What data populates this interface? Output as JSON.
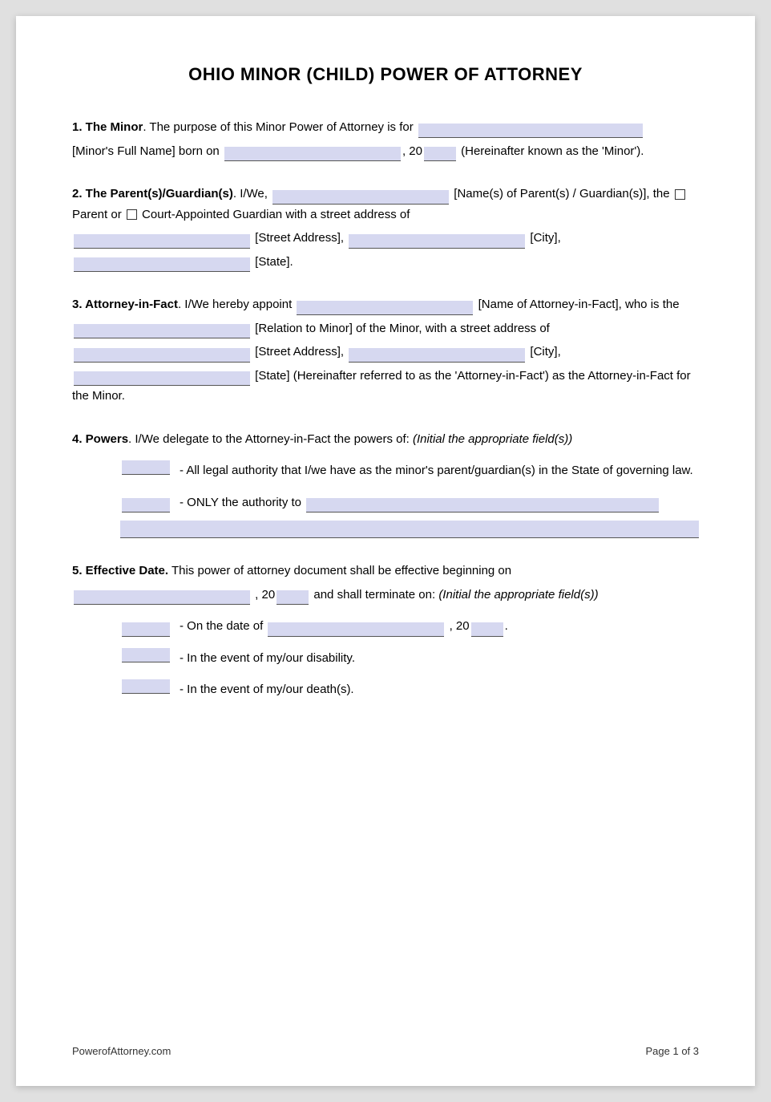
{
  "title": "OHIO MINOR (CHILD) POWER OF ATTORNEY",
  "sections": {
    "s1": {
      "label": "1. The Minor",
      "text1": ". The purpose of this Minor Power of Attorney is for",
      "text2": "[Minor's Full Name] born on",
      "text3": ", 20",
      "text4": "(Hereinafter known as the 'Minor')."
    },
    "s2": {
      "label": "2. The Parent(s)/Guardian(s)",
      "text1": ". I/We,",
      "text2": "[Name(s) of Parent(s) / Guardian(s)], the",
      "text3": "Parent or",
      "text4": "Court-Appointed Guardian with a street address of",
      "text5": "[Street Address],",
      "text6": "[City],",
      "text7": "[State]."
    },
    "s3": {
      "label": "3. Attorney-in-Fact",
      "text1": ". I/We hereby appoint",
      "text2": "[Name of Attorney-in-Fact], who is the",
      "text3": "[Relation to Minor] of the Minor, with a street address of",
      "text4": "[Street Address],",
      "text5": "[City],",
      "text6": "[State] (Hereinafter referred to as the 'Attorney-in-Fact') as the Attorney-in-Fact for the Minor."
    },
    "s4": {
      "label": "4. Powers",
      "text1": ". I/We delegate to the Attorney-in-Fact the powers of:",
      "text2": "(Initial the appropriate field(s))",
      "power1": "- All legal authority that I/we have as the minor's parent/guardian(s) in the State of governing law.",
      "power2": "- ONLY the authority to"
    },
    "s5": {
      "label": "5. Effective Date.",
      "text1": "This power of attorney document shall be effective beginning on",
      "text2": ", 20",
      "text3": "and shall terminate on:",
      "text4": "(Initial the appropriate field(s))",
      "opt1": "- On the date of",
      "opt1b": ", 20",
      "opt2": "- In the event of my/our disability.",
      "opt3": "- In the event of my/our death(s)."
    }
  },
  "footer": {
    "website": "PowerofAttorney.com",
    "page": "Page 1 of 3"
  }
}
